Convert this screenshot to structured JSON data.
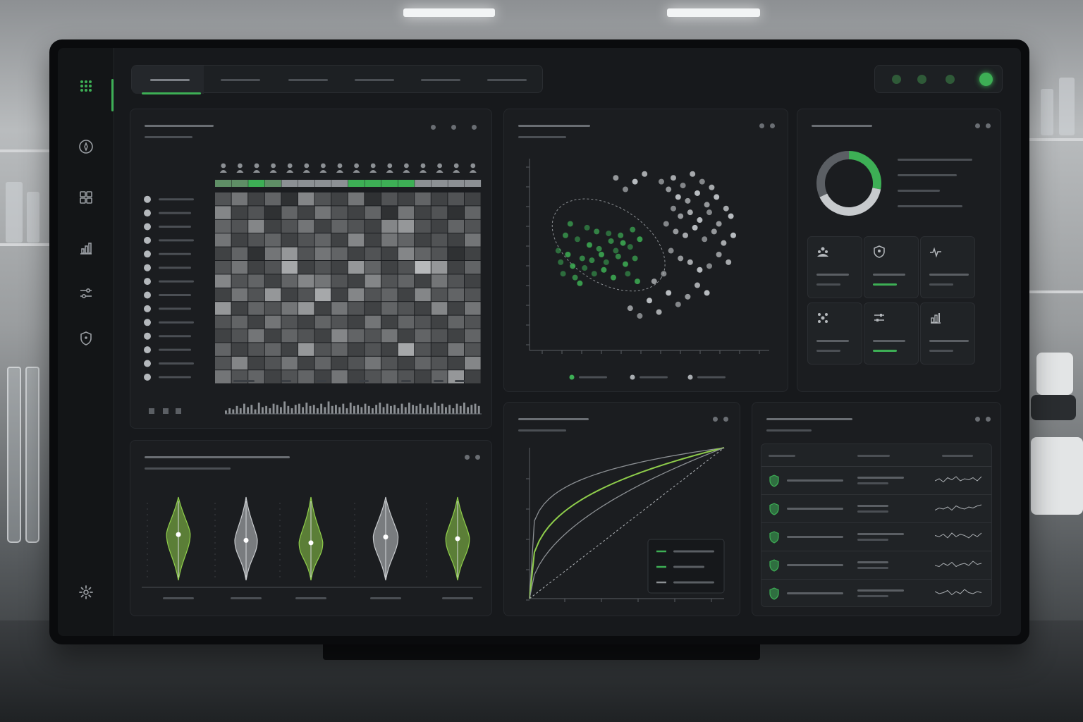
{
  "colors": {
    "accent": "#3daf55",
    "lime": "#8fce4b",
    "panel": "#1b1d20",
    "muted": "#4b4f54"
  },
  "tabs": [
    "",
    "",
    "",
    "",
    "",
    ""
  ],
  "active_tab": 0,
  "sidebar": {
    "items": [
      "grid-icon",
      "compass-icon",
      "dashboard-icon",
      "bar-chart-icon",
      "sliders-icon",
      "shield-icon"
    ],
    "bottom": "gear-icon"
  },
  "status_dots": [
    "#3a6e45",
    "#3a6e45",
    "#3a6e45",
    "#3daf55"
  ],
  "heatmap": {
    "title": "",
    "subtitle": "",
    "rows": 14,
    "cols": 16,
    "row_labels": [
      "",
      "",
      "",
      "",
      "",
      "",
      "",
      "",
      "",
      "",
      "",
      "",
      "",
      ""
    ],
    "col_groups": [
      {
        "cols": 4,
        "color": "#3daf55"
      },
      {
        "cols": 4,
        "color": "#8c9094"
      },
      {
        "cols": 4,
        "color": "#3daf55"
      },
      {
        "cols": 4,
        "color": "#8c9094"
      }
    ],
    "values": [
      [
        0.3,
        0.5,
        0.2,
        0.4,
        0.1,
        0.6,
        0.3,
        0.2,
        0.5,
        0.1,
        0.3,
        0.2,
        0.4,
        0.2,
        0.3,
        0.2
      ],
      [
        0.6,
        0.2,
        0.3,
        0.1,
        0.4,
        0.2,
        0.5,
        0.3,
        0.2,
        0.4,
        0.1,
        0.5,
        0.2,
        0.3,
        0.1,
        0.4
      ],
      [
        0.4,
        0.3,
        0.6,
        0.2,
        0.3,
        0.5,
        0.2,
        0.4,
        0.3,
        0.2,
        0.6,
        0.7,
        0.3,
        0.2,
        0.4,
        0.3
      ],
      [
        0.5,
        0.2,
        0.3,
        0.4,
        0.2,
        0.3,
        0.4,
        0.2,
        0.6,
        0.2,
        0.5,
        0.4,
        0.2,
        0.3,
        0.2,
        0.5
      ],
      [
        0.2,
        0.4,
        0.1,
        0.5,
        0.7,
        0.3,
        0.5,
        0.4,
        0.2,
        0.3,
        0.2,
        0.6,
        0.4,
        0.3,
        0.1,
        0.2
      ],
      [
        0.3,
        0.5,
        0.2,
        0.3,
        0.8,
        0.2,
        0.3,
        0.2,
        0.7,
        0.4,
        0.2,
        0.3,
        0.9,
        0.7,
        0.2,
        0.4
      ],
      [
        0.6,
        0.3,
        0.4,
        0.2,
        0.4,
        0.6,
        0.5,
        0.3,
        0.2,
        0.6,
        0.3,
        0.4,
        0.2,
        0.5,
        0.3,
        0.2
      ],
      [
        0.2,
        0.5,
        0.3,
        0.7,
        0.2,
        0.3,
        0.8,
        0.2,
        0.6,
        0.3,
        0.4,
        0.2,
        0.6,
        0.3,
        0.4,
        0.3
      ],
      [
        0.7,
        0.2,
        0.4,
        0.3,
        0.5,
        0.7,
        0.2,
        0.5,
        0.3,
        0.2,
        0.4,
        0.3,
        0.2,
        0.6,
        0.2,
        0.5
      ],
      [
        0.3,
        0.4,
        0.2,
        0.5,
        0.3,
        0.2,
        0.4,
        0.3,
        0.2,
        0.5,
        0.2,
        0.4,
        0.3,
        0.2,
        0.4,
        0.3
      ],
      [
        0.2,
        0.3,
        0.5,
        0.2,
        0.4,
        0.3,
        0.2,
        0.6,
        0.4,
        0.3,
        0.5,
        0.2,
        0.4,
        0.3,
        0.2,
        0.4
      ],
      [
        0.4,
        0.2,
        0.3,
        0.4,
        0.2,
        0.7,
        0.3,
        0.4,
        0.2,
        0.3,
        0.2,
        0.8,
        0.3,
        0.2,
        0.5,
        0.3
      ],
      [
        0.3,
        0.6,
        0.2,
        0.3,
        0.5,
        0.2,
        0.4,
        0.2,
        0.3,
        0.5,
        0.3,
        0.2,
        0.4,
        0.3,
        0.2,
        0.6
      ],
      [
        0.5,
        0.3,
        0.4,
        0.2,
        0.3,
        0.4,
        0.2,
        0.5,
        0.2,
        0.3,
        0.4,
        0.3,
        0.2,
        0.4,
        0.7,
        0.2
      ]
    ],
    "histogram": [
      3,
      5,
      4,
      7,
      5,
      9,
      6,
      8,
      4,
      10,
      6,
      7,
      5,
      9,
      8,
      6,
      11,
      7,
      5,
      8,
      9,
      6,
      10,
      7,
      8,
      5,
      9,
      6,
      11,
      7,
      8,
      6,
      9,
      5,
      10,
      7,
      8,
      6,
      9,
      7,
      5,
      8,
      10,
      6,
      9,
      7,
      8,
      5,
      9,
      6,
      10,
      8,
      7,
      9,
      5,
      8,
      6,
      10,
      7,
      9,
      6,
      8,
      5,
      9,
      7,
      10,
      6,
      8,
      9,
      7
    ]
  },
  "scatter": {
    "title": "",
    "subtitle": "",
    "series": [
      {
        "color": "#3daf55",
        "points": [
          [
            12,
            52
          ],
          [
            15,
            60
          ],
          [
            18,
            44
          ],
          [
            20,
            58
          ],
          [
            22,
            48
          ],
          [
            25,
            55
          ],
          [
            27,
            40
          ],
          [
            28,
            62
          ],
          [
            30,
            50
          ],
          [
            32,
            46
          ],
          [
            34,
            57
          ],
          [
            35,
            38
          ],
          [
            36,
            52
          ],
          [
            38,
            60
          ],
          [
            40,
            45
          ],
          [
            42,
            54
          ],
          [
            44,
            48
          ],
          [
            45,
            36
          ],
          [
            14,
            40
          ],
          [
            17,
            66
          ],
          [
            21,
            35
          ],
          [
            24,
            64
          ],
          [
            26,
            47
          ],
          [
            31,
            42
          ],
          [
            33,
            61
          ],
          [
            37,
            49
          ],
          [
            39,
            56
          ],
          [
            41,
            40
          ],
          [
            43,
            63
          ],
          [
            16,
            50
          ],
          [
            23,
            43
          ],
          [
            29,
            53
          ],
          [
            46,
            58
          ],
          [
            13,
            46
          ],
          [
            19,
            38
          ]
        ]
      },
      {
        "color": "#c9cdd0",
        "points": [
          [
            55,
            88
          ],
          [
            58,
            84
          ],
          [
            60,
            90
          ],
          [
            62,
            80
          ],
          [
            64,
            86
          ],
          [
            66,
            78
          ],
          [
            68,
            92
          ],
          [
            70,
            82
          ],
          [
            72,
            88
          ],
          [
            74,
            76
          ],
          [
            76,
            85
          ],
          [
            78,
            80
          ],
          [
            60,
            74
          ],
          [
            63,
            70
          ],
          [
            67,
            72
          ],
          [
            71,
            68
          ],
          [
            75,
            72
          ],
          [
            79,
            66
          ],
          [
            82,
            74
          ],
          [
            84,
            70
          ],
          [
            57,
            66
          ],
          [
            61,
            62
          ],
          [
            65,
            60
          ],
          [
            69,
            64
          ],
          [
            73,
            58
          ],
          [
            77,
            62
          ],
          [
            81,
            56
          ],
          [
            85,
            60
          ],
          [
            59,
            52
          ],
          [
            63,
            48
          ],
          [
            67,
            46
          ],
          [
            71,
            42
          ],
          [
            75,
            44
          ],
          [
            79,
            50
          ],
          [
            83,
            46
          ],
          [
            58,
            30
          ],
          [
            62,
            24
          ],
          [
            66,
            28
          ],
          [
            54,
            20
          ],
          [
            50,
            26
          ],
          [
            46,
            18
          ],
          [
            42,
            22
          ],
          [
            70,
            34
          ],
          [
            74,
            30
          ],
          [
            56,
            40
          ],
          [
            52,
            36
          ],
          [
            48,
            92
          ],
          [
            44,
            88
          ],
          [
            40,
            84
          ],
          [
            36,
            90
          ]
        ]
      }
    ],
    "legend": [
      "",
      "",
      ""
    ]
  },
  "donut": {
    "title": "",
    "segments": [
      {
        "value": 0.28,
        "color": "#3daf55"
      },
      {
        "value": 0.4,
        "color": "#c7cacd"
      },
      {
        "value": 0.32,
        "color": "#5b5f64"
      }
    ]
  },
  "tiles": [
    {
      "icon": "people-icon",
      "value": "",
      "label": "",
      "accent": false
    },
    {
      "icon": "shield-icon",
      "value": "",
      "label": "",
      "accent": true
    },
    {
      "icon": "pulse-icon",
      "value": "",
      "label": "",
      "accent": false
    },
    {
      "icon": "molecule-icon",
      "value": "",
      "label": "",
      "accent": false
    },
    {
      "icon": "filter-icon",
      "value": "",
      "label": "",
      "accent": true
    },
    {
      "icon": "bar-chart-icon",
      "value": "",
      "label": "",
      "accent": false
    }
  ],
  "violin": {
    "title": "",
    "subtitle": "",
    "groups": [
      {
        "color": "#8fce4b",
        "median": 0.55,
        "spread": 0.42
      },
      {
        "color": "#c7cacd",
        "median": 0.48,
        "spread": 0.4
      },
      {
        "color": "#8fce4b",
        "median": 0.45,
        "spread": 0.42
      },
      {
        "color": "#c7cacd",
        "median": 0.52,
        "spread": 0.44
      },
      {
        "color": "#8fce4b",
        "median": 0.5,
        "spread": 0.42
      }
    ]
  },
  "roc": {
    "title": "",
    "subtitle": "",
    "curves": [
      {
        "color": "#8c9094",
        "power": 0.18
      },
      {
        "color": "#8fce4b",
        "power": 0.32
      },
      {
        "color": "#8c9094",
        "power": 0.5
      }
    ],
    "legend": [
      {
        "color": "#3daf55",
        "label": ""
      },
      {
        "color": "#3daf55",
        "label": ""
      },
      {
        "color": "#8c9094",
        "label": ""
      }
    ]
  },
  "table": {
    "title": "",
    "subtitle": "",
    "columns": [
      "",
      "",
      ""
    ],
    "rows": [
      {
        "name": "",
        "value": "",
        "spark": [
          4,
          6,
          3,
          7,
          5,
          8,
          4,
          6,
          5,
          7,
          4,
          8
        ]
      },
      {
        "name": "",
        "value": "",
        "spark": [
          3,
          5,
          4,
          6,
          3,
          7,
          5,
          4,
          6,
          5,
          7,
          8
        ]
      },
      {
        "name": "",
        "value": "",
        "spark": [
          5,
          4,
          6,
          3,
          7,
          4,
          6,
          5,
          3,
          6,
          4,
          7
        ]
      },
      {
        "name": "",
        "value": "",
        "spark": [
          4,
          3,
          6,
          4,
          7,
          3,
          5,
          6,
          4,
          8,
          5,
          6
        ]
      },
      {
        "name": "",
        "value": "",
        "spark": [
          6,
          4,
          5,
          7,
          3,
          6,
          4,
          8,
          5,
          4,
          6,
          5
        ]
      }
    ]
  }
}
